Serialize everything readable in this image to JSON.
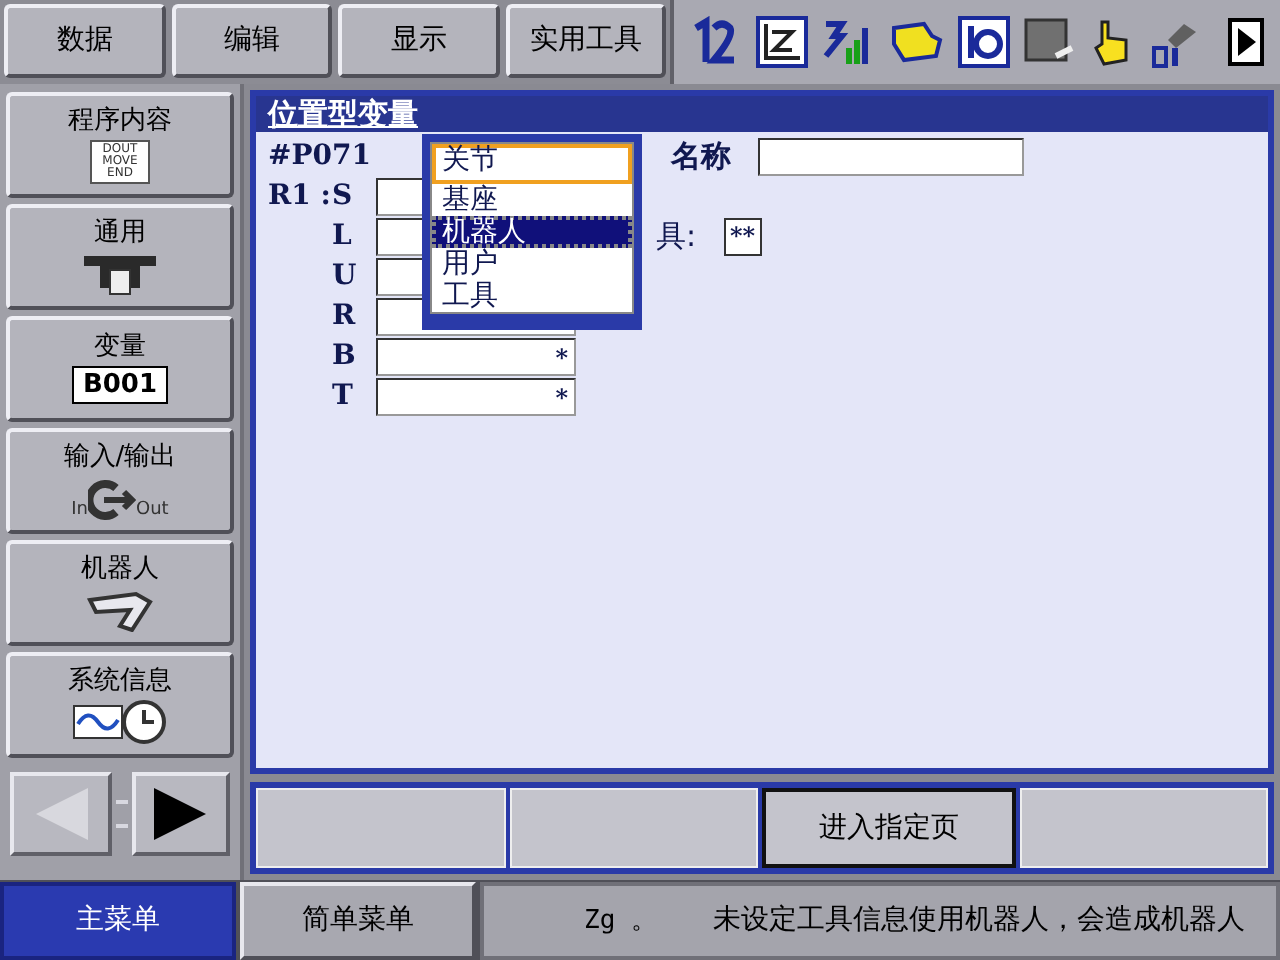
{
  "menu_bar": {
    "buttons": [
      {
        "label": "数据"
      },
      {
        "label": "编辑"
      },
      {
        "label": "显示"
      },
      {
        "label": "实用工具"
      }
    ]
  },
  "sidebar": {
    "items": [
      {
        "label": "程序内容",
        "kind": "program",
        "icon_lines": [
          "DOUT",
          "MOVE",
          "END"
        ]
      },
      {
        "label": "通用",
        "kind": "tool"
      },
      {
        "label": "变量",
        "kind": "variable",
        "badge": "B001"
      },
      {
        "label": "输入/输出",
        "kind": "io",
        "icon_in": "In",
        "icon_out": "Out"
      },
      {
        "label": "机器人",
        "kind": "robot"
      },
      {
        "label": "系统信息",
        "kind": "system"
      }
    ],
    "nav": {
      "back_enabled": false,
      "forward_enabled": true
    }
  },
  "panel": {
    "title": "位置型变量",
    "variable": "#P071",
    "name_label": "名称",
    "group": "R1 :",
    "axes": [
      {
        "label": "S"
      },
      {
        "label": "L"
      },
      {
        "label": "U"
      },
      {
        "label": "R"
      },
      {
        "label": "B",
        "value": "*"
      },
      {
        "label": "T",
        "value": "*"
      }
    ],
    "tool_label": "具:",
    "tool_value": "**",
    "dropdown": {
      "items": [
        {
          "label": "关节",
          "selected": false,
          "focused": true
        },
        {
          "label": "基座",
          "selected": false,
          "focused": false
        },
        {
          "label": "机器人",
          "selected": true,
          "focused": false
        },
        {
          "label": "用户",
          "selected": false,
          "focused": false
        },
        {
          "label": "工具",
          "selected": false,
          "focused": false
        }
      ]
    }
  },
  "function_keys": [
    {
      "kind": "blank"
    },
    {
      "kind": "blank"
    },
    {
      "kind": "button",
      "label": "进入指定页"
    },
    {
      "kind": "blank"
    }
  ],
  "status_bar": {
    "tabs": [
      {
        "label": "主菜单",
        "selected": true
      },
      {
        "label": "简单菜单",
        "selected": false
      }
    ],
    "code": "Zg 。",
    "message": "未设定工具信息使用机器人，会造成机器人"
  }
}
